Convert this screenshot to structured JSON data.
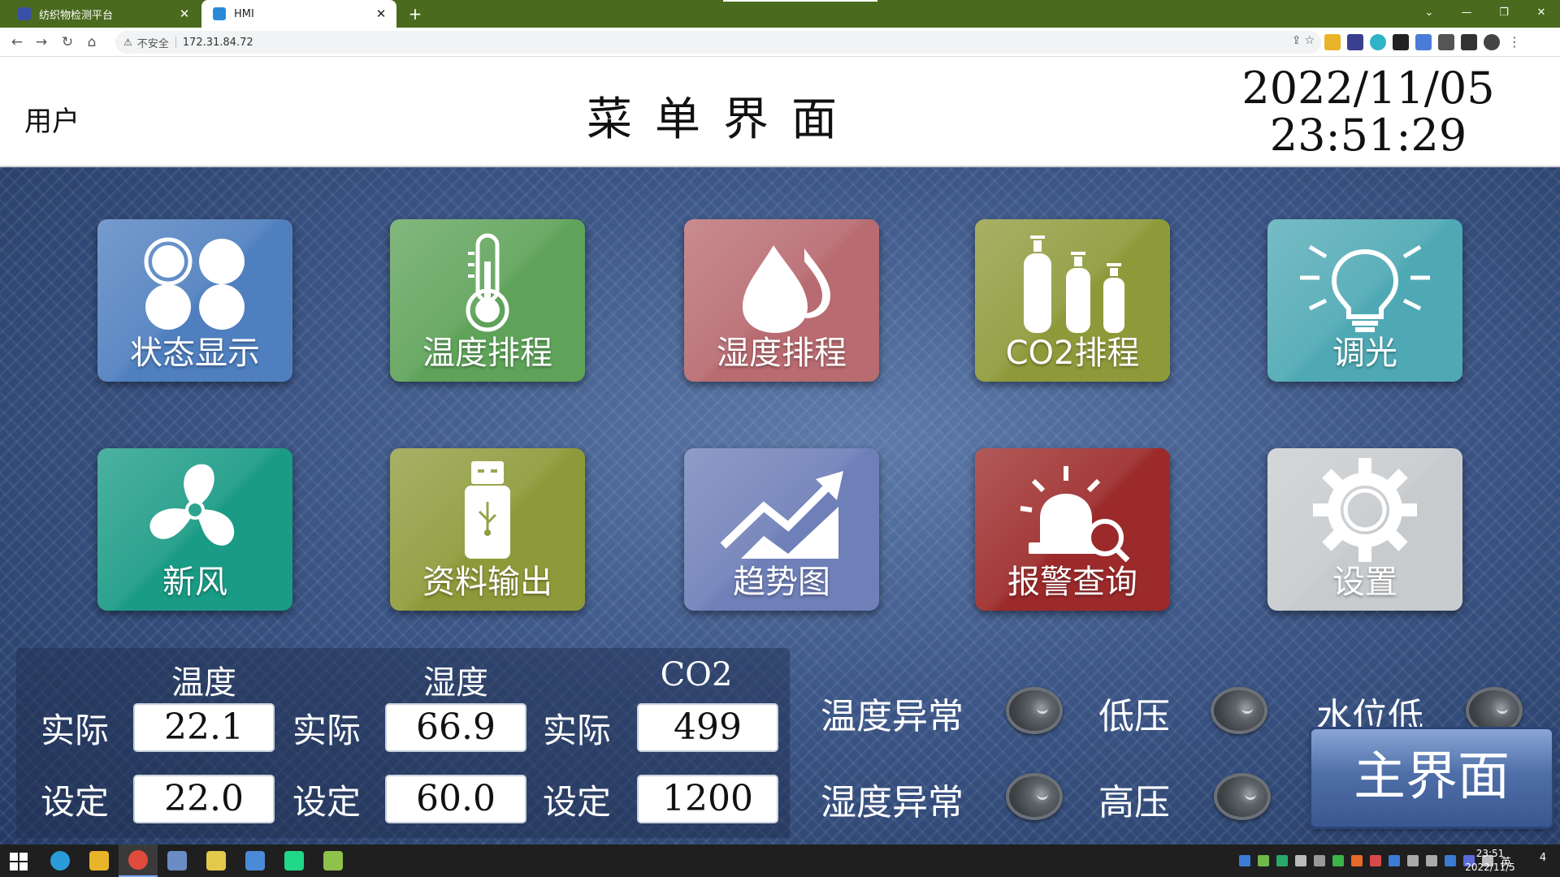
{
  "browser": {
    "tabs": [
      {
        "title": "纺织物检测平台",
        "active": false
      },
      {
        "title": "HMI",
        "active": true
      }
    ],
    "new_tab": "+",
    "address": {
      "security_label": "不安全",
      "url": "172.31.84.72"
    },
    "window_controls": {
      "minimize": "—",
      "restore": "❐",
      "close": "✕",
      "tab_search": "⌄"
    }
  },
  "hmi": {
    "user_label": "用户",
    "title": "菜单界面",
    "clock": {
      "date": "2022/11/05",
      "time": "23:51:29"
    },
    "tiles": [
      {
        "label": "状态显示",
        "icon": "four-circles-icon",
        "color": "#4f7fbf"
      },
      {
        "label": "温度排程",
        "icon": "thermometer-icon",
        "color": "#5fa35a"
      },
      {
        "label": "湿度排程",
        "icon": "water-drops-icon",
        "color": "#b86b70"
      },
      {
        "label": "CO2排程",
        "icon": "gas-cylinders-icon",
        "color": "#8e9a3a"
      },
      {
        "label": "调光",
        "icon": "light-bulb-icon",
        "color": "#4fa9b4"
      },
      {
        "label": "新风",
        "icon": "fan-icon",
        "color": "#1a9b85"
      },
      {
        "label": "资料输出",
        "icon": "usb-drive-icon",
        "color": "#8e9a3a"
      },
      {
        "label": "趋势图",
        "icon": "trend-chart-icon",
        "color": "#6f7fb8"
      },
      {
        "label": "报警查询",
        "icon": "alarm-search-icon",
        "color": "#9c2a2a"
      },
      {
        "label": "设置",
        "icon": "gear-icon",
        "color": "#c8cbce"
      }
    ],
    "sensors": {
      "headers": [
        "温度",
        "湿度",
        "CO2"
      ],
      "actual_label": "实际",
      "setpoint_label": "设定",
      "actual": [
        "22.1",
        "66.9",
        "499"
      ],
      "setpoint": [
        "22.0",
        "60.0",
        "1200"
      ]
    },
    "alarms": [
      {
        "label": "温度异常",
        "state": "off"
      },
      {
        "label": "低压",
        "state": "off"
      },
      {
        "label": "水位低",
        "state": "off"
      },
      {
        "label": "湿度异常",
        "state": "off"
      },
      {
        "label": "高压",
        "state": "off"
      }
    ],
    "main_button": "主界面"
  },
  "taskbar": {
    "ime": "英",
    "clock_time": "23:51",
    "clock_date": "2022/11/5",
    "notifications": "4"
  }
}
